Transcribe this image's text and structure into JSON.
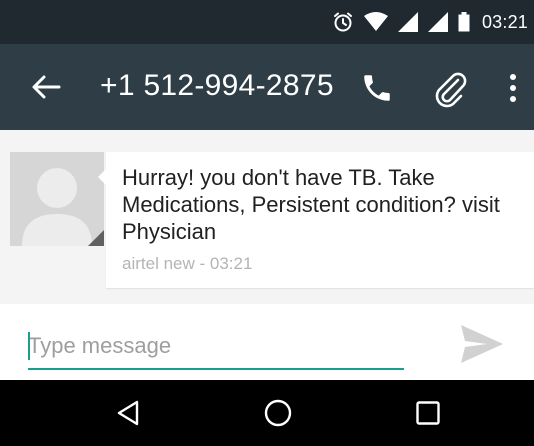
{
  "status_bar": {
    "time": "03:21",
    "icons": [
      "alarm-icon",
      "wifi-icon",
      "signal-icon",
      "signal-icon",
      "battery-icon"
    ]
  },
  "app_bar": {
    "title": "+1 512-994-2875",
    "icons": [
      "back-arrow-icon",
      "phone-icon",
      "paperclip-icon",
      "more-vert-icon"
    ]
  },
  "conversation": {
    "messages": [
      {
        "text": "Hurray! you don't have TB. Take Medications, Persistent condition? visit Physician",
        "meta": "airtel new - 03:21",
        "avatar_icon": "person-avatar-icon"
      }
    ]
  },
  "compose": {
    "placeholder": "Type message",
    "value": "",
    "send_icon": "send-icon"
  },
  "nav_bar": {
    "icons": [
      "nav-back-icon",
      "nav-home-icon",
      "nav-recents-icon"
    ]
  },
  "colors": {
    "status_bar_bg": "#1f292f",
    "app_bar_bg": "#2f3e46",
    "accent": "#19a08c",
    "conversation_bg": "#f4f4f4",
    "bubble_bg": "#ffffff",
    "meta_text": "#b4b4b4",
    "nav_bar_bg": "#000000"
  }
}
